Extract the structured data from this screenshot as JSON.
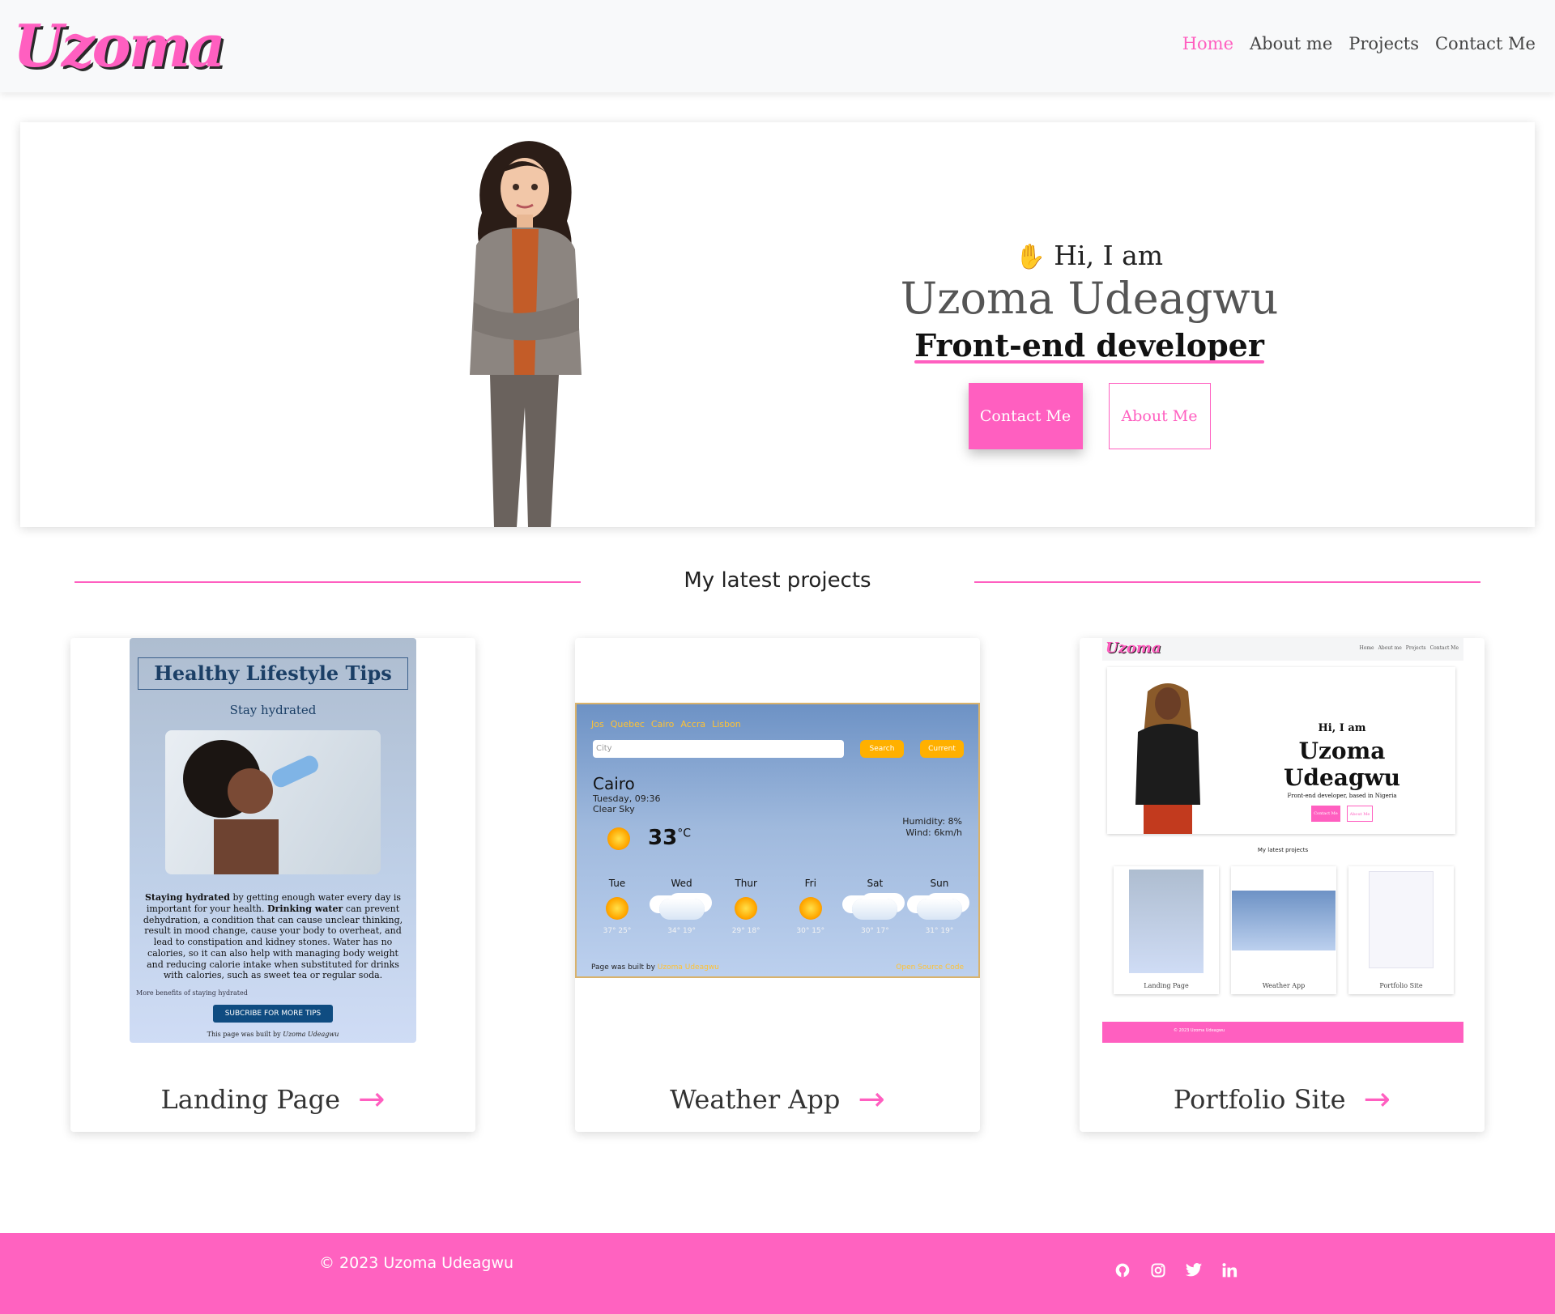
{
  "brand": {
    "logo": "Uzoma",
    "accent_color": "#ff5fc0"
  },
  "nav": {
    "items": [
      {
        "label": "Home",
        "active": true
      },
      {
        "label": "About me",
        "active": false
      },
      {
        "label": "Projects",
        "active": false
      },
      {
        "label": "Contact Me",
        "active": false
      }
    ]
  },
  "hero": {
    "greeting": "Hi, I am",
    "wave_icon": "waving-hand-icon",
    "name": "Uzoma Udeagwu",
    "role": "Front-end developer",
    "primary_button": "Contact Me",
    "secondary_button": "About Me"
  },
  "projects": {
    "section_title": "My latest projects",
    "cards": [
      {
        "title": "Landing Page",
        "arrow_icon": "arrow-right-icon"
      },
      {
        "title": "Weather App",
        "arrow_icon": "arrow-right-icon"
      },
      {
        "title": "Portfolio Site",
        "arrow_icon": "arrow-right-icon"
      }
    ]
  },
  "landing_preview": {
    "title": "Healthy Lifestyle Tips",
    "subtitle": "Stay hydrated",
    "body_lead": "Staying hydrated",
    "body_1": " by getting enough water every day is important for your health. ",
    "body_lead_2": "Drinking water",
    "body_2": " can prevent dehydration, a condition that can cause unclear thinking, result in mood change, cause your body to overheat, and lead to constipation and kidney stones. Water has no calories, so it can also help with managing body weight and reducing calorie intake when substituted for drinks with calories, such as sweet tea or regular soda.",
    "more_link": "More benefits of staying hydrated",
    "button": "SUBCRIBE FOR MORE TIPS",
    "footer_prefix": "This page was built by",
    "footer_author": "Uzoma Udeagwu"
  },
  "weather_preview": {
    "cities": [
      "Jos",
      "Quebec",
      "Cairo",
      "Accra",
      "Lisbon"
    ],
    "search_placeholder": "City",
    "search_button": "Search",
    "current_button": "Current",
    "city": "Cairo",
    "date": "Tuesday, 09:36",
    "condition": "Clear Sky",
    "temperature": "33",
    "unit": "°C",
    "humidity": "Humidity: 8%",
    "wind": "Wind: 6km/h",
    "forecast": [
      {
        "day": "Tue",
        "range": "37° 25°",
        "icon": "sun-icon"
      },
      {
        "day": "Wed",
        "range": "34° 19°",
        "icon": "cloud-icon"
      },
      {
        "day": "Thur",
        "range": "29° 18°",
        "icon": "sun-icon"
      },
      {
        "day": "Fri",
        "range": "30° 15°",
        "icon": "sun-icon"
      },
      {
        "day": "Sat",
        "range": "30° 17°",
        "icon": "cloud-icon"
      },
      {
        "day": "Sun",
        "range": "31° 19°",
        "icon": "cloud-icon"
      }
    ],
    "footer_prefix": "Page was built by",
    "footer_author": "Uzoma Udeagwu",
    "footer_source": "Open Source Code"
  },
  "portfolio_preview": {
    "logo": "Uzoma",
    "nav": [
      "Home",
      "About me",
      "Projects",
      "Contact Me"
    ],
    "greeting": "Hi, I am",
    "name": "Uzoma Udeagwu",
    "role": "Front-end developer, based in Nigeria",
    "primary_button": "Contact Me",
    "secondary_button": "About Me",
    "projects_title": "My latest projects",
    "mini_cards": [
      "Landing Page",
      "Weather App",
      "Portfolio Site"
    ],
    "footer_copy": "© 2023 Uzoma Udeagwu"
  },
  "footer": {
    "copyright": "© 2023 Uzoma Udeagwu",
    "social_icons": [
      "github-icon",
      "instagram-icon",
      "twitter-icon",
      "linkedin-icon"
    ],
    "background_color": "#ff62c0"
  }
}
